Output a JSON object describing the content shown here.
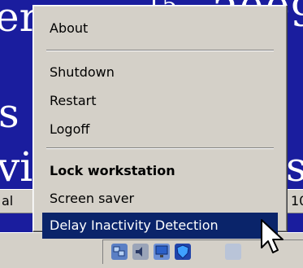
{
  "background": {
    "fragments": [
      "er",
      "15",
      "2009",
      "s",
      "vi",
      "st",
      "al",
      "10"
    ]
  },
  "context_menu": {
    "items": [
      {
        "label": "About",
        "bold": false,
        "highlighted": false
      },
      {
        "label": "Shutdown",
        "bold": false,
        "highlighted": false
      },
      {
        "label": "Restart",
        "bold": false,
        "highlighted": false
      },
      {
        "label": "Logoff",
        "bold": false,
        "highlighted": false
      },
      {
        "label": "Lock workstation",
        "bold": true,
        "highlighted": false
      },
      {
        "label": "Screen saver",
        "bold": false,
        "highlighted": false
      },
      {
        "label": "Delay Inactivity Detection",
        "bold": false,
        "highlighted": true
      }
    ]
  },
  "tray": {
    "icons": [
      "network-icon",
      "volume-icon",
      "monitor-icon",
      "shield-icon",
      "app-icon"
    ]
  },
  "colors": {
    "desktop": "#1a1d9e",
    "menu_bg": "#d4d0c8",
    "highlight": "#0a246a",
    "highlight_text": "#ffffff"
  }
}
